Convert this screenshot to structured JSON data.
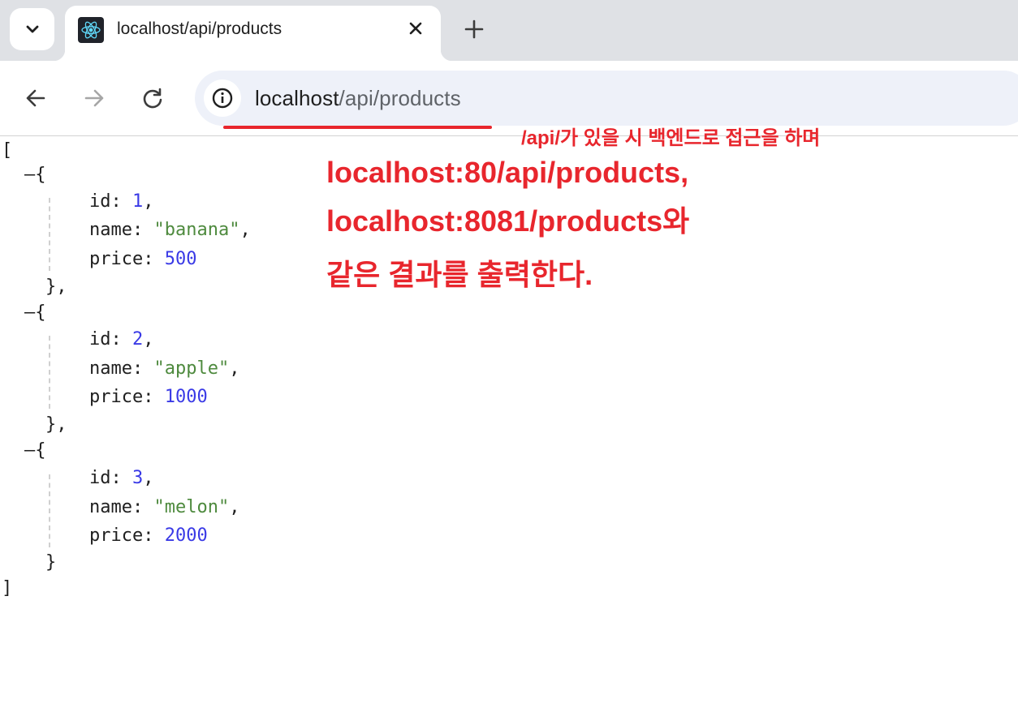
{
  "browser": {
    "tab": {
      "title": "localhost/api/products"
    },
    "address_bar": {
      "host": "localhost",
      "path": "/api/products"
    }
  },
  "annotation": {
    "note": "/api/가 있을 시 백엔드로 접근을 하며",
    "line1": "localhost:80/api/products,",
    "line2": "localhost:8081/products와",
    "line3": "같은 결과를 출력한다.",
    "color": "#e8262d"
  },
  "json_view": {
    "open_bracket": "[",
    "close_bracket": "]",
    "items": [
      {
        "id": "1",
        "name": "\"banana\"",
        "price": "500",
        "close": "},"
      },
      {
        "id": "2",
        "name": "\"apple\"",
        "price": "1000",
        "close": "},"
      },
      {
        "id": "3",
        "name": "\"melon\"",
        "price": "2000",
        "close": "}"
      }
    ],
    "keys": {
      "id": "id",
      "name": "name",
      "price": "price"
    },
    "toggle_symbol": "–",
    "open_brace": "{"
  },
  "icons": {
    "tab_menu": "chevron-down-icon",
    "favicon": "react-logo-icon",
    "close": "close-icon",
    "new_tab": "plus-icon",
    "back": "arrow-left-icon",
    "forward": "arrow-right-icon",
    "reload": "reload-icon",
    "site_info": "info-icon"
  }
}
